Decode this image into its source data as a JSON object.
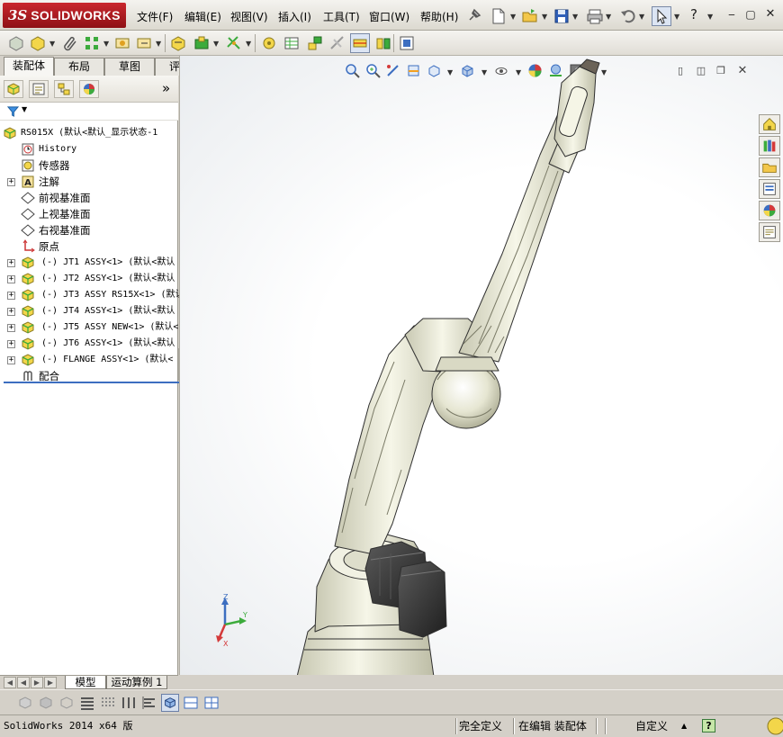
{
  "app": {
    "logo_ds": "3S",
    "logo_brand": "SOLIDWORKS",
    "menu": [
      "文件(F)",
      "编辑(E)",
      "视图(V)",
      "插入(I)",
      "工具(T)",
      "窗口(W)",
      "帮助(H)"
    ],
    "help_glyph": "?"
  },
  "tabs": [
    {
      "label": "装配体",
      "active": true
    },
    {
      "label": "布局",
      "active": false
    },
    {
      "label": "草图",
      "active": false
    },
    {
      "label": "评估",
      "active": false
    }
  ],
  "feature_tree": {
    "collapse_glyph": "»",
    "root": "RS015X  (默认<默认_显示状态-1",
    "items": [
      {
        "label": "History",
        "icon": "history-icon",
        "expander": ""
      },
      {
        "label": "传感器",
        "icon": "sensor-icon",
        "expander": ""
      },
      {
        "label": "注解",
        "icon": "annotation-icon",
        "expander": "+"
      },
      {
        "label": "前视基准面",
        "icon": "plane-icon",
        "expander": ""
      },
      {
        "label": "上视基准面",
        "icon": "plane-icon",
        "expander": ""
      },
      {
        "label": "右视基准面",
        "icon": "plane-icon",
        "expander": ""
      },
      {
        "label": "原点",
        "icon": "origin-icon",
        "expander": ""
      },
      {
        "label": "(-) JT1 ASSY<1> (默认<默认",
        "icon": "subassembly-icon",
        "expander": "+"
      },
      {
        "label": "(-) JT2 ASSY<1> (默认<默认",
        "icon": "subassembly-icon",
        "expander": "+"
      },
      {
        "label": "(-) JT3 ASSY RS15X<1> (默认",
        "icon": "subassembly-icon",
        "expander": "+"
      },
      {
        "label": "(-) JT4 ASSY<1> (默认<默认",
        "icon": "subassembly-icon",
        "expander": "+"
      },
      {
        "label": "(-) JT5 ASSY NEW<1> (默认<",
        "icon": "subassembly-icon",
        "expander": "+"
      },
      {
        "label": "(-) JT6 ASSY<1> (默认<默认",
        "icon": "subassembly-icon",
        "expander": "+"
      },
      {
        "label": "(-) FLANGE ASSY<1> (默认<",
        "icon": "subassembly-icon",
        "expander": "+"
      },
      {
        "label": "配合",
        "icon": "mates-icon",
        "expander": ""
      }
    ]
  },
  "bottom_tabs": [
    {
      "label": "模型",
      "active": true
    },
    {
      "label": "运动算例 1",
      "active": false
    }
  ],
  "triad": {
    "z": "Z",
    "y": "Y",
    "x": "X"
  },
  "status": {
    "version": "SolidWorks 2014 x64 版",
    "definition": "完全定义",
    "mode": "在编辑 装配体",
    "units": "自定义",
    "help": "?"
  },
  "colors": {
    "brand_red": "#b71c22",
    "accent_blue": "#3c6ec0",
    "robot_body": "#ececd8",
    "motor_dark": "#3a3a3a"
  }
}
